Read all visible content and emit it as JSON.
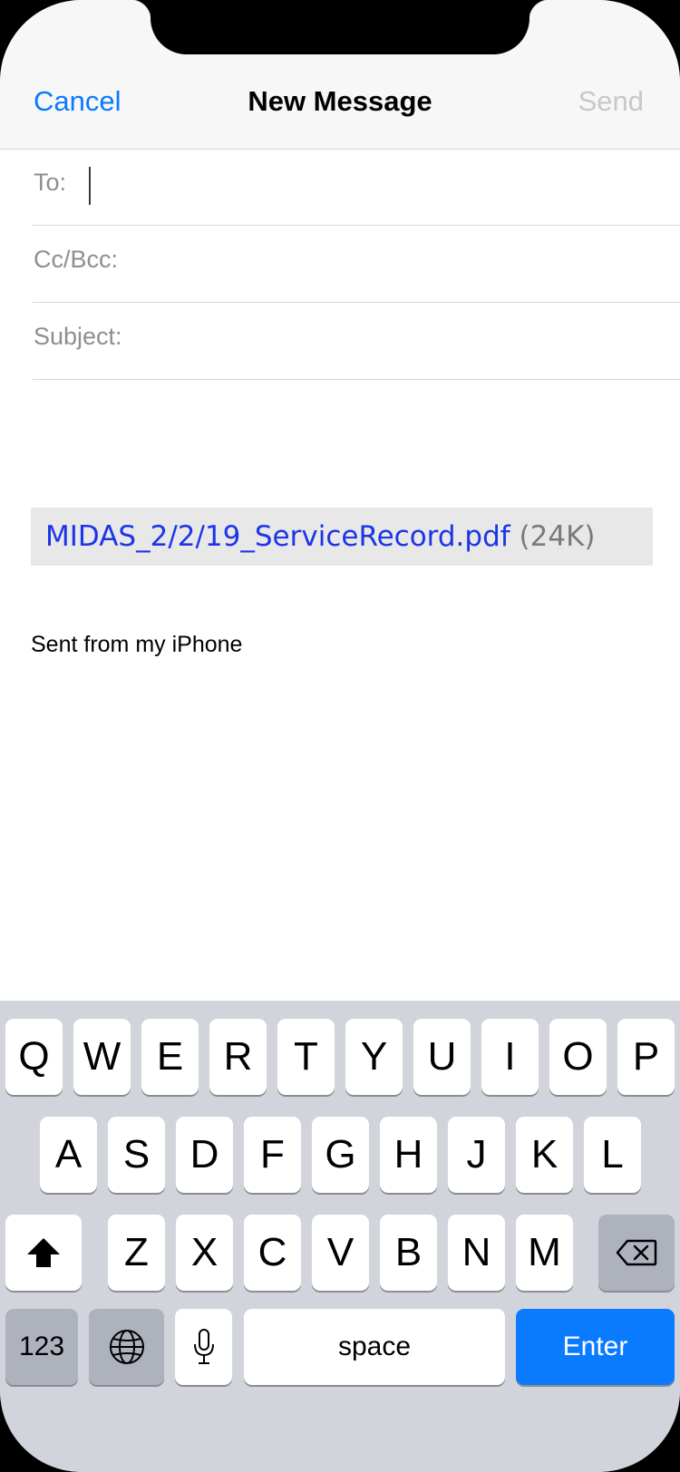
{
  "navbar": {
    "cancel_label": "Cancel",
    "title": "New Message",
    "send_label": "Send"
  },
  "fields": {
    "to_label": "To:",
    "to_value": "",
    "ccbcc_label": "Cc/Bcc:",
    "ccbcc_value": "",
    "subject_label": "Subject:",
    "subject_value": ""
  },
  "attachment": {
    "filename": "MIDAS_2/2/19_ServiceRecord.pdf",
    "size": "(24K)"
  },
  "body": {
    "signature": "Sent from my iPhone"
  },
  "keyboard": {
    "row1": [
      "Q",
      "W",
      "E",
      "R",
      "T",
      "Y",
      "U",
      "I",
      "O",
      "P"
    ],
    "row2": [
      "A",
      "S",
      "D",
      "F",
      "G",
      "H",
      "J",
      "K",
      "L"
    ],
    "row3": [
      "Z",
      "X",
      "C",
      "V",
      "B",
      "N",
      "M"
    ],
    "numbers_label": "123",
    "space_label": "space",
    "enter_label": "Enter",
    "shift_icon": "shift-arrow-icon",
    "delete_icon": "backspace-icon",
    "globe_icon": "globe-icon",
    "mic_icon": "microphone-icon"
  },
  "colors": {
    "accent": "#0a7aff",
    "attachment_link": "#1c35e8",
    "send_disabled": "#c7c7cc",
    "keyboard_bg": "#d2d4db"
  }
}
